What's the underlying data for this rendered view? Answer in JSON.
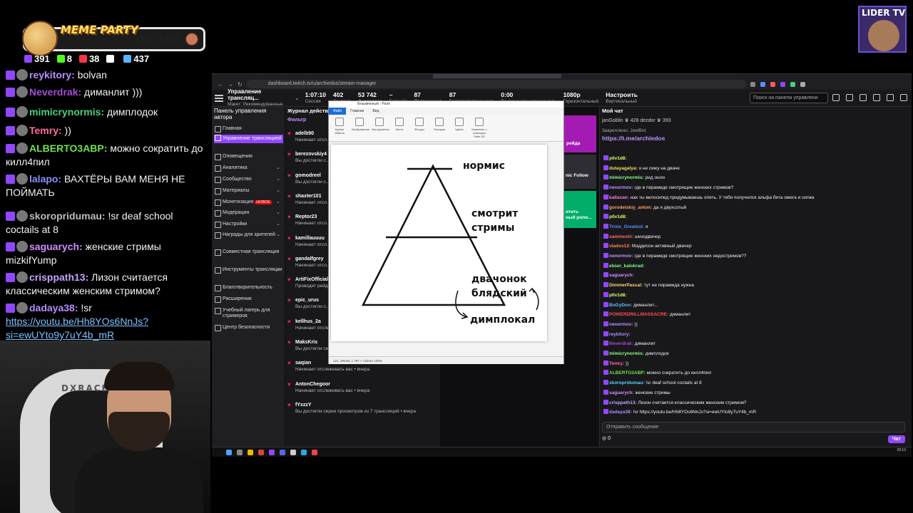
{
  "overlay": {
    "party_title": "MEME PARTY",
    "party_count": "152 / 1000",
    "party_progress": 0.152,
    "stats": [
      {
        "icon": "twitch-icon",
        "value": "391",
        "color": "#9147ff"
      },
      {
        "icon": "kick-icon",
        "value": "8",
        "color": "#53fc18"
      },
      {
        "icon": "vk-live-icon",
        "value": "38",
        "color": "#ff3347"
      },
      {
        "icon": "w-icon",
        "value": "",
        "color": "#ffffff"
      },
      {
        "icon": "viewers-icon",
        "value": "437",
        "color": "#5ab4ff"
      }
    ],
    "chat": [
      {
        "nick": "reykitory:",
        "text": "bolvan",
        "color": "#b58cff"
      },
      {
        "nick": "Neverdrak:",
        "text": "диманлит )))",
        "color": "#a64ad9"
      },
      {
        "nick": "mimicrynormis:",
        "text": "димплодок",
        "color": "#45d37a"
      },
      {
        "nick": "Temry:",
        "text": "))",
        "color": "#ff6ba0"
      },
      {
        "nick": "ALBERTO3ABP:",
        "text": "можно сократить до килл4пил",
        "color": "#72e04a"
      },
      {
        "nick": "lalapo:",
        "text": "ВАХТЁРЫ ВАМ МЕНЯ НЕ ПОЙМАТЬ",
        "color": "#8a8fff"
      },
      {
        "nick": "skoropridumau:",
        "text": "!sr deaf school coctails at 8",
        "color": "#bdbdbd"
      },
      {
        "nick": "saguarych:",
        "text": "женские стримы mizkifYump",
        "color": "#d58cff"
      },
      {
        "nick": "crisppath13:",
        "text": "Лизон считается классическим женским стримом?",
        "color": "#c4a3ff"
      },
      {
        "nick": "dadaya38:",
        "text": "!sr",
        "color": "#b58cff",
        "link": "https://youtu.be/Hh8YOs6NnJs?si=ewUYto9y7uY4b_mR"
      }
    ],
    "logo_text": "LIDER TV",
    "chair_text": "DXRACER"
  },
  "browser": {
    "url": "dashboard.twitch.tv/u/archiedos/stream-manager",
    "title": "Управление трансляц...",
    "subtitle": "Макет: Рекомендованные",
    "metrics": [
      {
        "value": "1:07:10",
        "label": "Сессия"
      },
      {
        "value": "402",
        "label": "Зрителя"
      },
      {
        "value": "53 742",
        "label": "Фолловера"
      },
      {
        "value": "–",
        "label": "Битрейт"
      },
      {
        "value": "87",
        "label": "Подписчиков"
      },
      {
        "value": "87",
        "label": "Баллов подписчиков"
      },
      {
        "value": "0:00",
        "label": "Реклама при запуске вкл."
      },
      {
        "value": "1080p",
        "label": "Горизонтальный"
      },
      {
        "value": "Настроить",
        "label": "Вертикальный"
      }
    ],
    "search_placeholder": "Поиск на панели управлени",
    "sidebar_title": "Панель управления автора",
    "sidebar": [
      {
        "label": "Главная",
        "chev": false
      },
      {
        "label": "Управление трансляцией",
        "active": true
      },
      {
        "label": "Оповещения"
      },
      {
        "label": "Аналитика",
        "chev": true
      },
      {
        "label": "Сообщество",
        "chev": true
      },
      {
        "label": "Материалы",
        "chev": true
      },
      {
        "label": "Монетизация",
        "badge": "НОВОЕ",
        "chev": true
      },
      {
        "label": "Модерация",
        "chev": true
      },
      {
        "label": "Настройки",
        "chev": true
      },
      {
        "label": "Награды для зрителей",
        "chev": true
      },
      {
        "label": "Совместная трансляция"
      },
      {
        "label": "Инструменты трансляции",
        "chev": true
      },
      {
        "label": "Благотворительность"
      },
      {
        "label": "Расширения"
      },
      {
        "label": "Учебный лагерь для стримеров"
      },
      {
        "label": "Центр безопасности"
      }
    ],
    "log_title": "Журнал действий",
    "log_filter": "Фильтр",
    "log": [
      {
        "name": "adelb90",
        "text": "Начинает отсл..."
      },
      {
        "name": "berezovskiy4",
        "text": "Вы достигли с... минут назад"
      },
      {
        "name": "gomodreel",
        "text": "Вы достигли с... минут назад"
      },
      {
        "name": "shaxter101",
        "text": "Начинает отсл..."
      },
      {
        "name": "Reptor23",
        "text": "Начинает отсл..."
      },
      {
        "name": "kamillauuuu",
        "text": "Начинает отсл..."
      },
      {
        "name": "gandalfgrey",
        "text": "Начинает отсл..."
      },
      {
        "name": "ArtiFixOfficial",
        "text": "Проводит рейд... зрителей. •"
      },
      {
        "name": "epic_urus",
        "text": "Вы достигли с... назад"
      },
      {
        "name": "kellhus_2a",
        "text": "Начинает отслеживать вас • вчера"
      },
      {
        "name": "MaksKris",
        "text": "Вы достигли серии просмотров из 7 трансляций • вчера"
      },
      {
        "name": "saqian",
        "text": "Начинает отслеживать вас • вчера"
      },
      {
        "name": "AntonChegoor",
        "text": "Начинает отслеживать вас • вчера"
      },
      {
        "name": "fYxzzY",
        "text": "Вы достигли серии просмотров из 7 трансляций • вчера"
      }
    ],
    "mid_blocks": [
      "рейда",
      "nic Follow",
      "отить\nный роли..."
    ],
    "paint": {
      "title": "Безымянный - Paint",
      "tabs": [
        "Файл",
        "Главная",
        "Вид"
      ],
      "tools": [
        "Буфер обмена",
        "Изображение",
        "Инструменты",
        "Кисти",
        "Фигуры",
        "Толщина",
        "Цвета",
        "Изменить с помощью Paint 3D"
      ],
      "labels": [
        "нормис",
        "смотрит",
        "стримы",
        "двачонок",
        "блядский",
        "димплокал"
      ],
      "status": "121, 292пкс     1  787 × 722пкс                              100%"
    },
    "chat_title": "Мой чат",
    "chat_top_users": "janGoblin ♛ 428   dezdor ♛ 393",
    "pinned_label": "Закреплено: JeetBot",
    "pinned_link": "https://t.me/archiedos",
    "chat": [
      {
        "n": "p0v1d8:",
        "t": "",
        "c": "#d5ff66"
      },
      {
        "n": "dutayagalya:",
        "t": "я не сижу на дваче",
        "c": "#e6e65a"
      },
      {
        "n": "mimicrynormis:",
        "t": "рид онли",
        "c": "#8bff8b"
      },
      {
        "n": "nenormov:",
        "t": "где в пирамиде смотрящие женских стримов?",
        "c": "#bf94ff"
      },
      {
        "n": "kallaxan:",
        "t": "нах ты велосипед придумываешь опять. У тебя получился альфа бета омега и сигма",
        "c": "#ff7bd9"
      },
      {
        "n": "gorodetskiy_anton:",
        "t": "да я двухсотый",
        "c": "#ff9e6b"
      },
      {
        "n": "p0v1d8:",
        "t": "",
        "c": "#d5ff66"
      },
      {
        "n": "Trixie_Greatest:",
        "t": "я",
        "c": "#5b8cff"
      },
      {
        "n": "sammeshi:",
        "t": "шизодвачер",
        "c": "#ff6b6b"
      },
      {
        "n": "vlados12:",
        "t": "Мэддисон активный двачер",
        "c": "#ff8a3d"
      },
      {
        "n": "nenormov:",
        "t": "где в пирамиде смотрящие женских недостримов??",
        "c": "#bf94ff"
      },
      {
        "n": "ebian_kalokrad:",
        "t": "",
        "c": "#7cff7c"
      },
      {
        "n": "saguarych:",
        "t": "",
        "c": "#d58cff"
      },
      {
        "n": "DimmerPascal:",
        "t": "тут не пирамида нужна",
        "c": "#ffd86b"
      },
      {
        "n": "p0v1d8:",
        "t": "",
        "c": "#d5ff66"
      },
      {
        "n": "BuGyDoo:",
        "t": "диманлит...",
        "c": "#5bbaff"
      },
      {
        "n": "POWERDRILLMASSACRE:",
        "t": "диманлит",
        "c": "#ff4d4d"
      },
      {
        "n": "nenormov:",
        "t": "))",
        "c": "#bf94ff"
      },
      {
        "n": "reykitory:",
        "t": "",
        "c": "#b58cff"
      },
      {
        "n": "Neverdrak:",
        "t": "диманлит",
        "c": "#a64ad9"
      },
      {
        "n": "mimicrynormis:",
        "t": "димплодок",
        "c": "#8bff8b"
      },
      {
        "n": "Temry:",
        "t": "))",
        "c": "#ff6ba0"
      },
      {
        "n": "ALBERTO3ABP:",
        "t": "можно сократить до килл4пил",
        "c": "#72e04a"
      },
      {
        "n": "skoropridumau:",
        "t": "!sr deaf school coctails at 8",
        "c": "#5bd0ff"
      },
      {
        "n": "saguarych:",
        "t": "женские стримы",
        "c": "#d58cff"
      },
      {
        "n": "crisppath13:",
        "t": "Лизон считается классическим женским стримом?",
        "c": "#c4a3ff"
      },
      {
        "n": "dadaya38:",
        "t": "!sr https://youtu.be/Hh8YOs6NnJs?si=ewUYto9y7uY4b_mR",
        "c": "#b58cff"
      }
    ],
    "chat_placeholder": "Отправить сообщение",
    "chat_points": "0",
    "chat_send": "Чат",
    "clock": "20:12"
  }
}
